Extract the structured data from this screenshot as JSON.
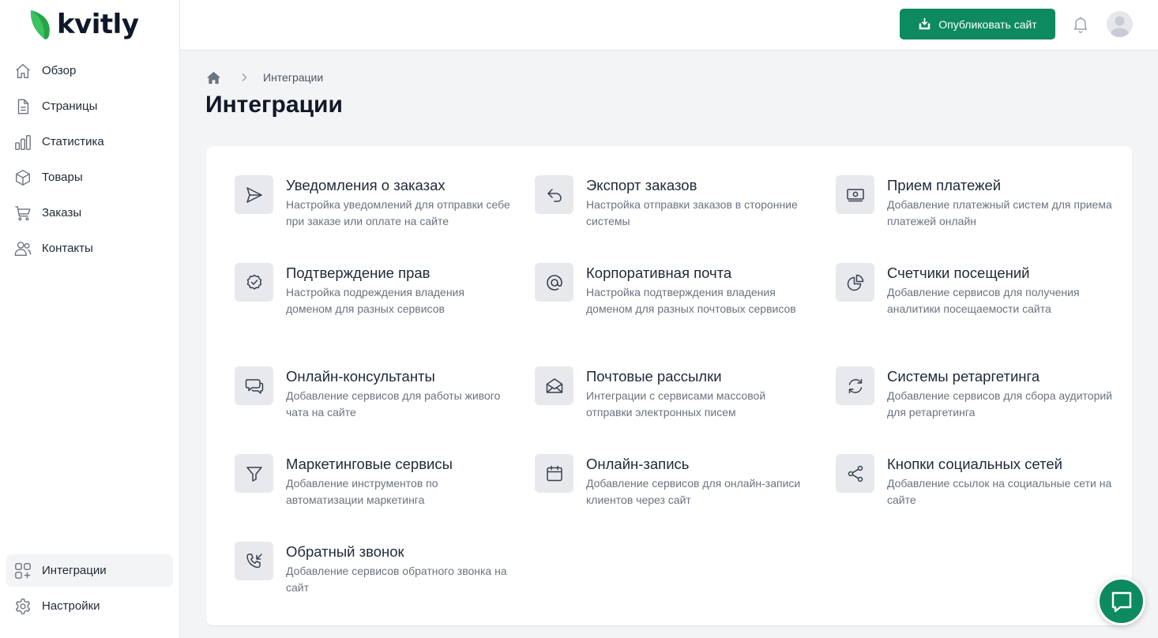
{
  "brand": {
    "name": "kvitly",
    "accent": "#0d8a5f"
  },
  "sidebar": {
    "items": [
      {
        "label": "Обзор",
        "icon": "home-icon"
      },
      {
        "label": "Страницы",
        "icon": "document-icon"
      },
      {
        "label": "Статистика",
        "icon": "bar-chart-icon"
      },
      {
        "label": "Товары",
        "icon": "box-icon"
      },
      {
        "label": "Заказы",
        "icon": "cart-icon"
      },
      {
        "label": "Контакты",
        "icon": "users-icon"
      }
    ],
    "bottom_items": [
      {
        "label": "Интеграции",
        "icon": "squares-plus-icon",
        "active": true
      },
      {
        "label": "Настройки",
        "icon": "gear-icon"
      }
    ]
  },
  "header": {
    "publish_label": "Опубликовать сайт"
  },
  "breadcrumb": {
    "current": "Интеграции"
  },
  "page": {
    "title": "Интеграции"
  },
  "integrations": [
    {
      "title": "Уведомления о заказах",
      "desc": "Настройка уведомлений для отправки себе при заказе или оплате на сайте",
      "icon": "paper-plane-icon"
    },
    {
      "title": "Экспорт заказов",
      "desc": "Настройка отправки заказов в сторонние системы",
      "icon": "undo-arrow-icon"
    },
    {
      "title": "Прием платежей",
      "desc": "Добавление платежный систем для приема платежей онлайн",
      "icon": "banknotes-icon"
    },
    {
      "title": "Подтверждение прав",
      "desc": "Настройка подреждения владения доменом для разных сервисов",
      "icon": "badge-check-icon"
    },
    {
      "title": "Корпоративная почта",
      "desc": "Настройка подтверждения владения доменом для разных почтовых сервисов",
      "icon": "at-sign-icon"
    },
    {
      "title": "Счетчики посещений",
      "desc": "Добавление сервисов для получения аналитики посещаемости сайта",
      "icon": "pie-chart-icon"
    },
    {
      "title": "Онлайн-консультанты",
      "desc": "Добавление сервисов для работы живого чата на сайте",
      "icon": "chat-bubbles-icon"
    },
    {
      "title": "Почтовые рассылки",
      "desc": "Интеграции с сервисами массовой отправки электронных писем",
      "icon": "envelope-open-icon"
    },
    {
      "title": "Системы ретаргетинга",
      "desc": "Добавление сервисов для сбора аудиторий для ретаргетинга",
      "icon": "refresh-icon"
    },
    {
      "title": "Маркетинговые сервисы",
      "desc": "Добавление инструментов по автоматизации маркетинга",
      "icon": "funnel-icon"
    },
    {
      "title": "Онлайн-запись",
      "desc": "Добавление сервисов для онлайн-записи клиентов через сайт",
      "icon": "calendar-icon"
    },
    {
      "title": "Кнопки социальных сетей",
      "desc": "Добавление ссылок на социальные сети на сайте",
      "icon": "share-icon"
    },
    {
      "title": "Обратный звонок",
      "desc": "Добавление сервисов обратного звонка на сайт",
      "icon": "phone-incoming-icon"
    }
  ]
}
